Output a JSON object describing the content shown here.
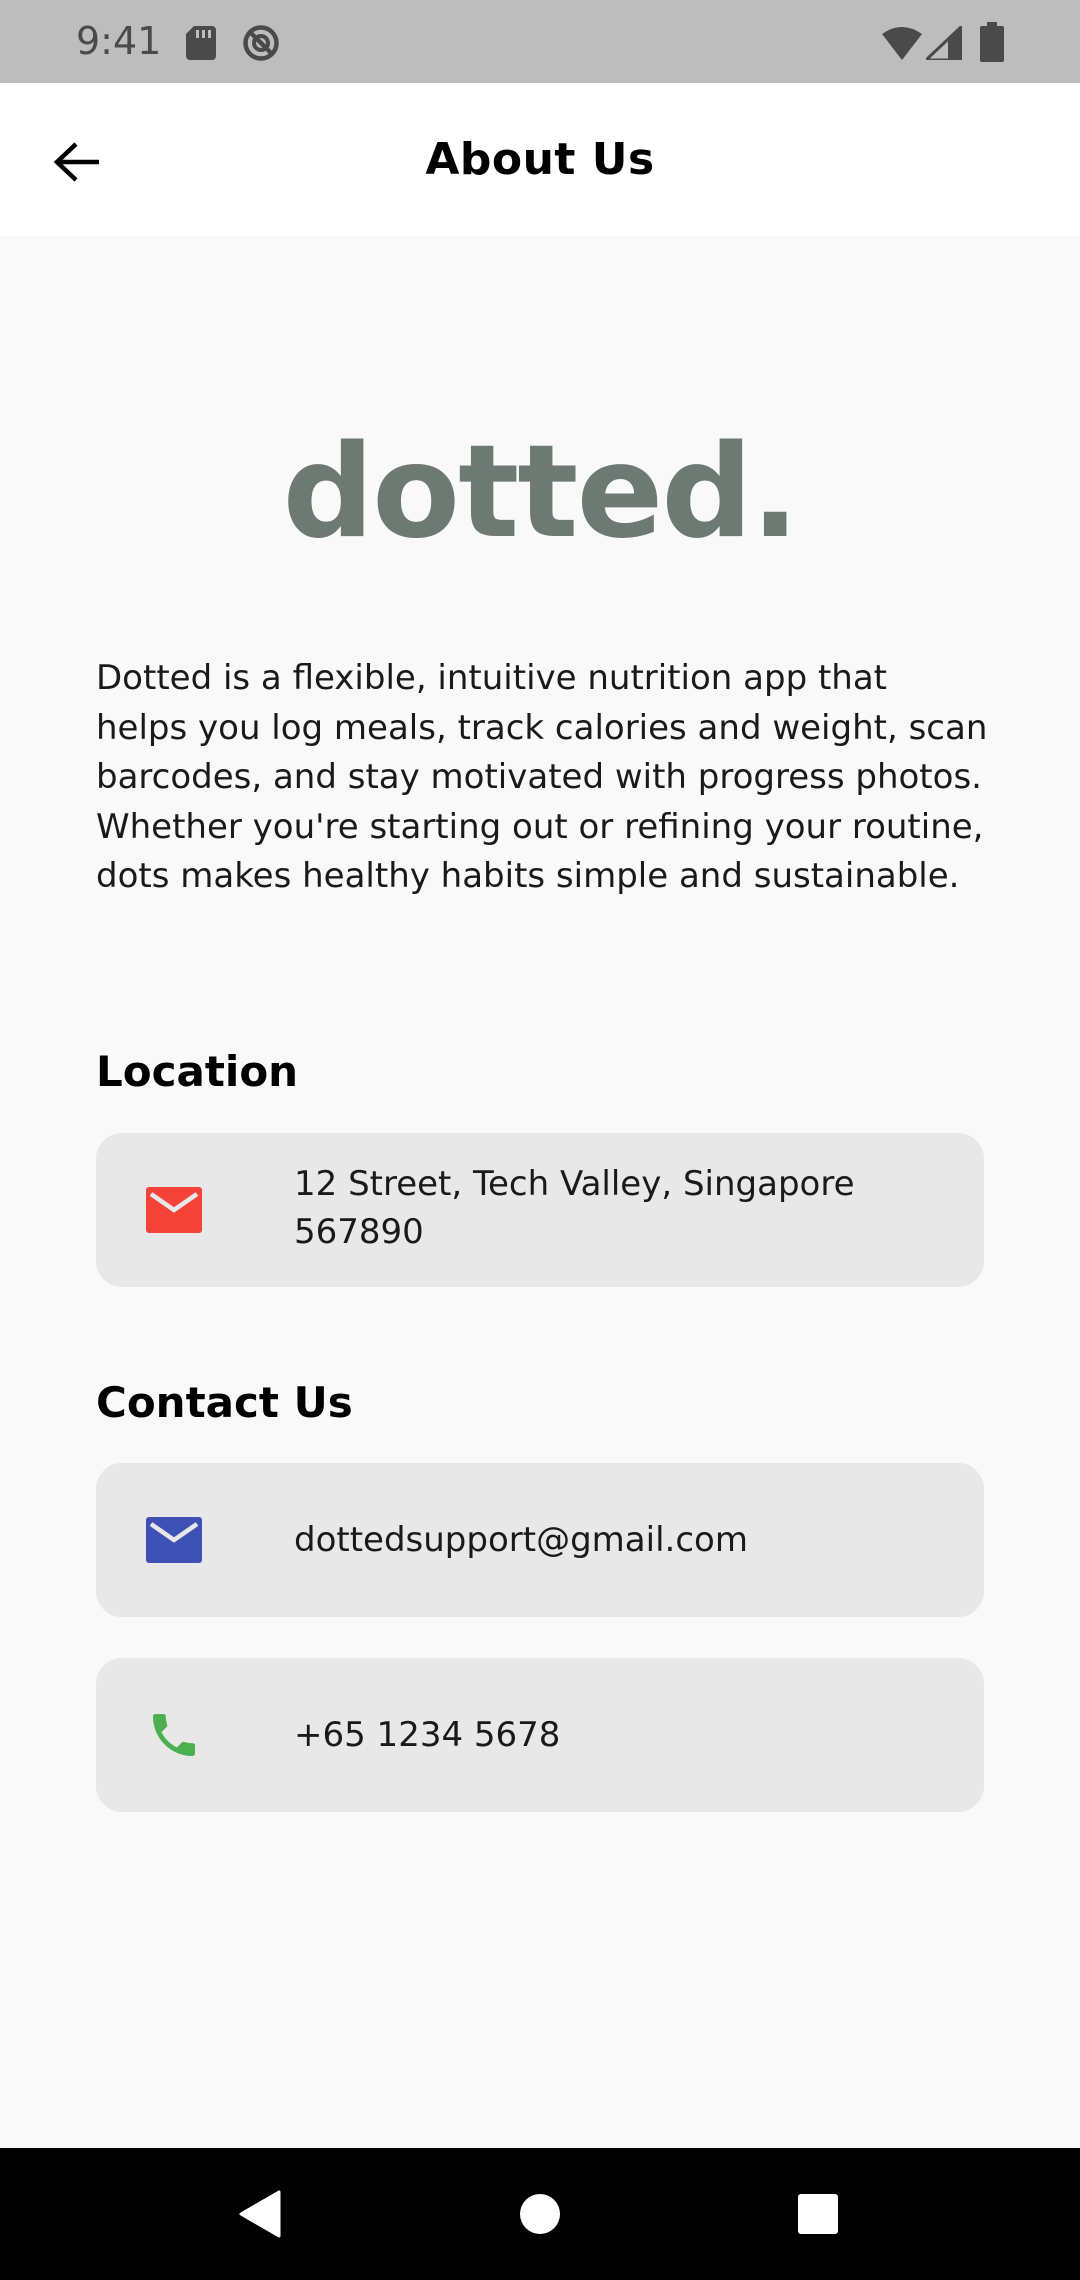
{
  "status_bar": {
    "time": "9:41"
  },
  "app_bar": {
    "title": "About Us",
    "back_icon": "arrow-back-icon"
  },
  "logo": {
    "text": "dotted.",
    "color": "#6d7a73"
  },
  "description": "Dotted is a flexible, intuitive nutrition app that helps you log meals, track calories and weight, scan barcodes, and stay motivated with progress photos. Whether you're starting out or refining your routine, dots makes healthy habits simple and sustainable.",
  "location": {
    "heading": "Location",
    "address": "12 Street, Tech Valley, Singapore 567890",
    "icon": "mail-icon",
    "icon_color": "#f44336"
  },
  "contact": {
    "heading": "Contact Us",
    "email": "dottedsupport@gmail.com",
    "email_icon": "mail-icon",
    "email_icon_color": "#3f51b5",
    "phone": "+65 1234 5678",
    "phone_icon": "phone-icon",
    "phone_icon_color": "#4caf50"
  },
  "nav_bar": {
    "buttons": [
      "back-icon",
      "home-icon",
      "recents-icon"
    ]
  }
}
